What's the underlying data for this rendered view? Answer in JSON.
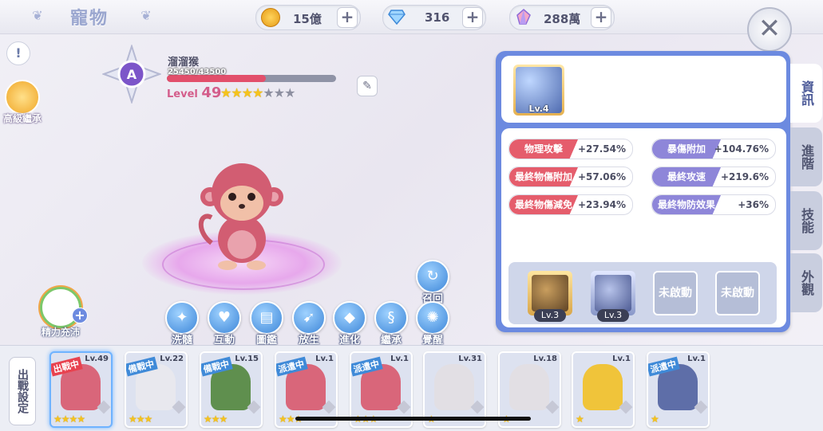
{
  "header": {
    "title": "寵物"
  },
  "currencies": [
    {
      "icon": "gold-coin-icon",
      "value": "15億"
    },
    {
      "icon": "diamond-icon",
      "value": "316"
    },
    {
      "icon": "crystal-icon",
      "value": "288萬"
    }
  ],
  "sidebar_left": {
    "inherit_label": "高級繼承"
  },
  "pet": {
    "rank": "A",
    "name": "溜溜猴",
    "exp_text": "25450/43500",
    "exp_fraction": 0.585,
    "level_label": "Level",
    "level": "49",
    "stars_filled": 4,
    "stars_total": 7
  },
  "energy": {
    "label": "精力充沛"
  },
  "recall": {
    "label": "召回"
  },
  "actions": [
    {
      "label": "洗髓",
      "icon": "wash-icon"
    },
    {
      "label": "互動",
      "icon": "heart-icon"
    },
    {
      "label": "圖鑑",
      "icon": "book-icon"
    },
    {
      "label": "放生",
      "icon": "fish-icon"
    },
    {
      "label": "進化",
      "icon": "crystal-icon"
    },
    {
      "label": "繼承",
      "icon": "dna-icon"
    },
    {
      "label": "覺醒",
      "icon": "awaken-icon"
    }
  ],
  "panel": {
    "main_skill_level": "Lv.4",
    "stats": [
      {
        "name": "物理攻擊",
        "value": "+27.54%",
        "color": "red"
      },
      {
        "name": "暴傷附加",
        "value": "+104.76%",
        "color": "purple"
      },
      {
        "name": "最終物傷附加",
        "value": "+57.06%",
        "color": "red"
      },
      {
        "name": "最終攻速",
        "value": "+219.6%",
        "color": "purple"
      },
      {
        "name": "最終物傷減免",
        "value": "+23.94%",
        "color": "red"
      },
      {
        "name": "最終物防效果",
        "value": "+36%",
        "color": "purple"
      }
    ],
    "skill_slots": [
      {
        "level": "Lv.3",
        "locked": false
      },
      {
        "level": "Lv.3",
        "locked": false
      },
      {
        "label": "未啟動",
        "locked": true
      },
      {
        "label": "未啟動",
        "locked": true
      }
    ]
  },
  "tabs": [
    {
      "label": "資訊",
      "active": true
    },
    {
      "label": "進階",
      "active": false
    },
    {
      "label": "技能",
      "active": false
    },
    {
      "label": "外觀",
      "active": false
    }
  ],
  "bottom": {
    "deploy_label": "出戰設定",
    "pets": [
      {
        "status": "出戰中",
        "status_color": "red",
        "level": "Lv.49",
        "stars": 4,
        "selected": true,
        "color": "#d9667a"
      },
      {
        "status": "備戰中",
        "status_color": "blue",
        "level": "Lv.22",
        "stars": 3,
        "selected": false,
        "color": "#e8e8ee"
      },
      {
        "status": "備戰中",
        "status_color": "blue",
        "level": "Lv.15",
        "stars": 3,
        "selected": false,
        "color": "#5f8f4e"
      },
      {
        "status": "派遣中",
        "status_color": "blue",
        "level": "Lv.1",
        "stars": 3,
        "selected": false,
        "color": "#d9667a"
      },
      {
        "status": "派遣中",
        "status_color": "blue",
        "level": "Lv.1",
        "stars": 3,
        "selected": false,
        "color": "#d9667a"
      },
      {
        "status": "",
        "status_color": "",
        "level": "Lv.31",
        "stars": 1,
        "selected": false,
        "color": "#e2dfe4"
      },
      {
        "status": "",
        "status_color": "",
        "level": "Lv.18",
        "stars": 1,
        "selected": false,
        "color": "#e2dfe4"
      },
      {
        "status": "",
        "status_color": "",
        "level": "Lv.1",
        "stars": 1,
        "selected": false,
        "color": "#f0c43a"
      },
      {
        "status": "派遣中",
        "status_color": "blue",
        "level": "Lv.1",
        "stars": 1,
        "selected": false,
        "color": "#5e6ea8"
      }
    ]
  }
}
